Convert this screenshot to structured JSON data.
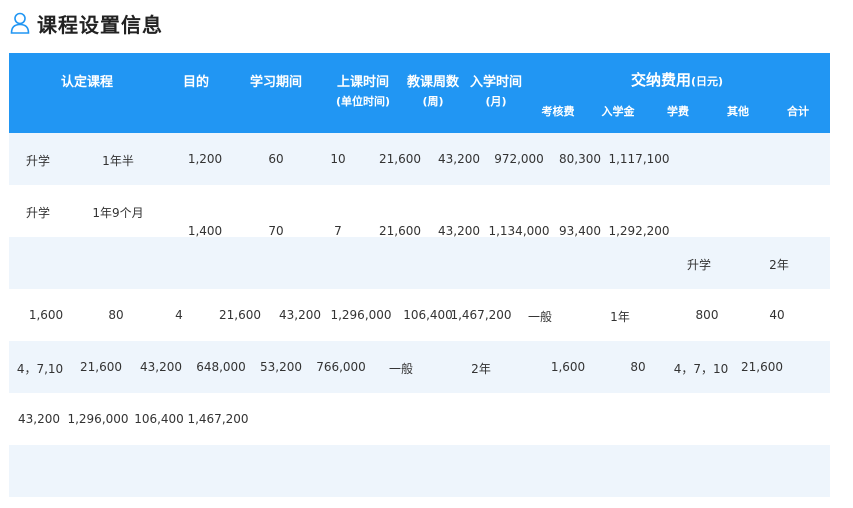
{
  "page": {
    "title": "课程设置信息",
    "title_icon": "user-outline-icon",
    "accent_color": "#2196f3"
  },
  "header": {
    "col1": "认定课程",
    "col2": "目的",
    "col3": "学习期间",
    "col4_line1": "上课时间",
    "col4_line2": "(单位时间)",
    "col5_line1": "教课周数",
    "col5_line2": "(周)",
    "col6_line1": "入学时间",
    "col6_line2": "(月)",
    "fees_title": "交纳费用",
    "fees_unit": "(日元)",
    "fee_exam": "考核费",
    "fee_admission": "入学金",
    "fee_tuition": "学费",
    "fee_other": "其他",
    "fee_total": "合计"
  },
  "rows": [
    [
      "升学",
      "1年半",
      "1,200",
      "60",
      "10",
      "21,600",
      "43,200",
      "972,000",
      "80,300",
      "1,117,100"
    ],
    [
      "升学",
      "1年9个月",
      "1,400",
      "70",
      "7",
      "21,600",
      "43,200",
      "1,134,000",
      "93,400",
      "1,292,200"
    ],
    [
      "升学",
      "2年"
    ],
    [
      "1,600",
      "80",
      "4",
      "21,600",
      "43,200",
      "1,296,000",
      "106,400",
      "1,467,200",
      "一般",
      "1年",
      "800",
      "40"
    ],
    [
      "4，7,10",
      "21,600",
      "43,200",
      "648,000",
      "53,200",
      "766,000",
      "一般",
      "2年",
      "1,600",
      "80",
      "4，7，10",
      "21,600"
    ],
    [
      "43,200",
      "1,296,000",
      "106,400",
      "1,467,200"
    ],
    []
  ]
}
